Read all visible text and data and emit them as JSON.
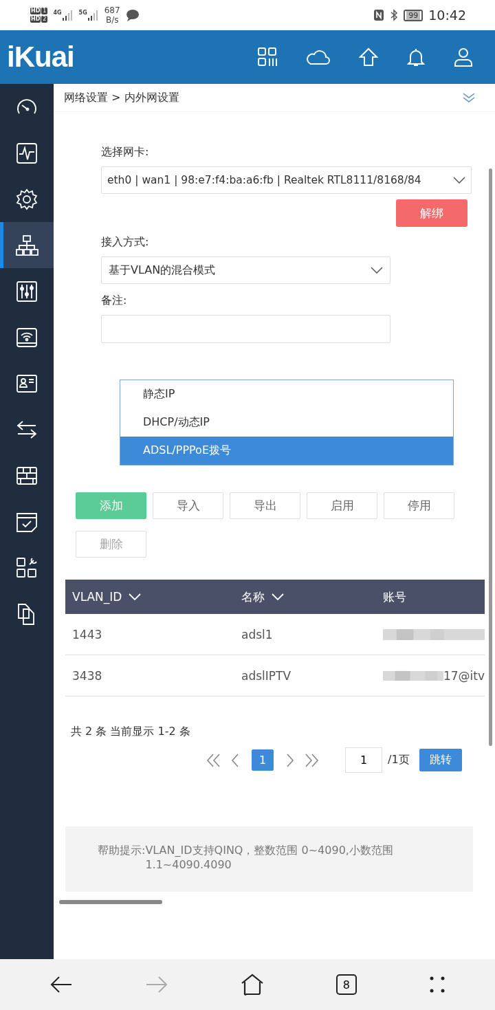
{
  "status_bar": {
    "sim_badges": [
      {
        "label": "HD",
        "slot": "1"
      },
      {
        "label": "HD",
        "slot": "2"
      }
    ],
    "networks": [
      {
        "label": "4G"
      },
      {
        "label": "5G"
      }
    ],
    "speed": "687",
    "speed_unit": "B/s",
    "battery": "99",
    "time": "10:42"
  },
  "header": {
    "logo": "iKuai"
  },
  "sidebar": {
    "items": [
      {
        "kind": "gauge",
        "selected": false
      },
      {
        "kind": "pulse",
        "selected": false
      },
      {
        "kind": "gear",
        "selected": false
      },
      {
        "kind": "network",
        "selected": true
      },
      {
        "kind": "sliders",
        "selected": false
      },
      {
        "kind": "wifi",
        "selected": false
      },
      {
        "kind": "user-card",
        "selected": false
      },
      {
        "kind": "arrows",
        "selected": false
      },
      {
        "kind": "wall",
        "selected": false
      },
      {
        "kind": "check-note",
        "selected": false
      },
      {
        "kind": "apps",
        "selected": false
      },
      {
        "kind": "files",
        "selected": false
      }
    ]
  },
  "breadcrumb": "网络设置 > 内外网设置",
  "form": {
    "nic_label": "选择网卡:",
    "nic_value": "eth0 | wan1 | 98:e7:f4:ba:a6:fb | Realtek RTL8111/8168/84",
    "unbind_button": "解绑",
    "access_label": "接入方式:",
    "access_value": "基于VLAN的混合模式",
    "note_label": "备注:"
  },
  "dropdown_list": {
    "options": [
      {
        "label": "静态IP",
        "selected": false
      },
      {
        "label": "DHCP/动态IP",
        "selected": false
      },
      {
        "label": "ADSL/PPPoE拨号",
        "selected": true
      }
    ]
  },
  "toolbar": {
    "buttons": [
      {
        "label": "添加",
        "kind": "primary",
        "disabled": false
      },
      {
        "label": "导入",
        "kind": "default",
        "disabled": false
      },
      {
        "label": "导出",
        "kind": "default",
        "disabled": false
      },
      {
        "label": "启用",
        "kind": "default",
        "disabled": false
      },
      {
        "label": "停用",
        "kind": "default",
        "disabled": false
      },
      {
        "label": "删除",
        "kind": "default",
        "disabled": true
      }
    ]
  },
  "table": {
    "columns": [
      {
        "label": "VLAN_ID",
        "sortable": true
      },
      {
        "label": "名称",
        "sortable": true
      },
      {
        "label": "账号",
        "sortable": false
      }
    ],
    "rows": [
      {
        "vlan_id": "1443",
        "name": "adsl1",
        "account": ""
      },
      {
        "vlan_id": "3438",
        "name": "adslIPTV",
        "account": "17@itv"
      }
    ]
  },
  "pagination": {
    "summary": "共 2 条 当前显示 1-2 条",
    "current_page": "1",
    "page_input": "1",
    "total": "/1页",
    "go_button": "跳转"
  },
  "help": {
    "label": "帮助提示:",
    "text": "VLAN_ID支持QINQ，整数范围 0~4090,小数范围 1.1~4090.4090"
  },
  "bottom_nav": {
    "tab_count": "8"
  }
}
